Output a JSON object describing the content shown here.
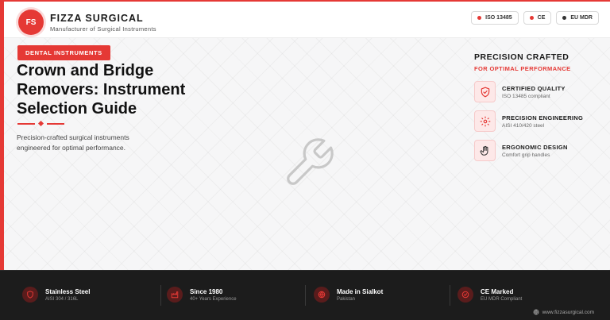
{
  "brand": {
    "logo_text": "FS",
    "name": "FIZZA SURGICAL",
    "tagline": "Manufacturer of Surgical Instruments"
  },
  "certifications": [
    {
      "label": "ISO 13485",
      "color": "#e53935"
    },
    {
      "label": "CE",
      "color": "#e53935"
    },
    {
      "label": "EU MDR",
      "color": "#333333"
    }
  ],
  "hero": {
    "category": "DENTAL INSTRUMENTS",
    "title": "Crown and Bridge Removers: Instrument Selection Guide",
    "description": "Precision-crafted surgical instruments engineered for optimal performance.",
    "center_icon": "wrench-icon"
  },
  "panel": {
    "title": "PRECISION CRAFTED",
    "subtitle": "FOR OPTIMAL PERFORMANCE",
    "features": [
      {
        "icon": "shield-check-icon",
        "title": "CERTIFIED QUALITY",
        "subtitle": "ISO 13485 compliant"
      },
      {
        "icon": "sun-gear-icon",
        "title": "PRECISION ENGINEERING",
        "subtitle": "AISI 410/420 steel"
      },
      {
        "icon": "hand-icon",
        "title": "ERGONOMIC DESIGN",
        "subtitle": "Comfort grip handles"
      }
    ]
  },
  "footer": {
    "items": [
      {
        "icon": "shield-icon",
        "label": "Stainless Steel",
        "value": "AISI 304 / 316L"
      },
      {
        "icon": "factory-icon",
        "label": "Since 1980",
        "value": "40+ Years Experience"
      },
      {
        "icon": "globe-icon",
        "label": "Made in Sialkot",
        "value": "Pakistan"
      },
      {
        "icon": "check-circle-icon",
        "label": "CE Marked",
        "value": "EU MDR Compliant"
      }
    ],
    "website": "www.fizzasurgical.com"
  },
  "colors": {
    "accent": "#e53935",
    "footer_bg": "#1c1c1c"
  }
}
